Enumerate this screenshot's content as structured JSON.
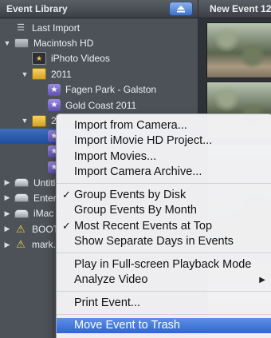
{
  "sidebar": {
    "title": "Event Library",
    "items": [
      {
        "label": "Last Import"
      },
      {
        "label": "Macintosh HD"
      },
      {
        "label": "iPhoto Videos"
      },
      {
        "label": "2011"
      },
      {
        "label": "Fagen Park - Galston"
      },
      {
        "label": "Gold Coast 2011"
      },
      {
        "label": "20"
      },
      {
        "label": ""
      },
      {
        "label": ""
      },
      {
        "label": ""
      },
      {
        "label": "Untitle"
      },
      {
        "label": "Entert"
      },
      {
        "label": "iMac C"
      },
      {
        "label": "BOOT"
      },
      {
        "label": "mark."
      }
    ]
  },
  "right": {
    "title": "New Event 12"
  },
  "menu": {
    "items": [
      {
        "label": "Import from Camera..."
      },
      {
        "label": "Import iMovie HD Project..."
      },
      {
        "label": "Import Movies..."
      },
      {
        "label": "Import Camera Archive..."
      },
      {
        "label": "Group Events by Disk"
      },
      {
        "label": "Group Events By Month"
      },
      {
        "label": "Most Recent Events at Top"
      },
      {
        "label": "Show Separate Days in Events"
      },
      {
        "label": "Play in Full-screen Playback Mode"
      },
      {
        "label": "Analyze Video"
      },
      {
        "label": "Print Event..."
      },
      {
        "label": "Move Event to Trash"
      }
    ],
    "checkmark": "✓"
  }
}
